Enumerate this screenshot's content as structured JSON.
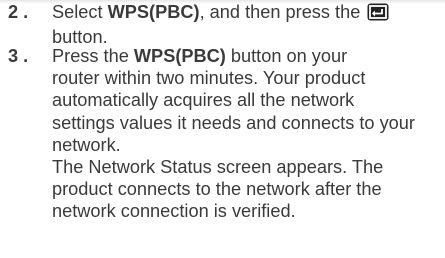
{
  "steps": [
    {
      "number": "2 .",
      "lines": [
        [
          "Select ",
          "WPS(PBC)",
          ", and then press the "
        ],
        [
          "button."
        ]
      ],
      "icon": "enter-button-icon"
    },
    {
      "number": "3 .",
      "lines": [
        [
          "Press the ",
          "WPS(PBC)",
          " button on your"
        ],
        [
          "router within two minutes. Your product"
        ],
        [
          "automatically acquires all the network"
        ],
        [
          "settings values it needs and connects to your"
        ],
        [
          "network."
        ],
        [
          "The Network Status screen appears. The"
        ],
        [
          "product connects to the network after the"
        ],
        [
          "network connection is verified."
        ]
      ]
    }
  ]
}
